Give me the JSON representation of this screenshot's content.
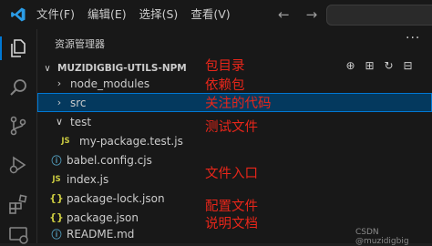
{
  "menu": {
    "items": [
      "文件(F)",
      "编辑(E)",
      "选择(S)",
      "查看(V)"
    ]
  },
  "explorer": {
    "title": "资源管理器",
    "more": "···",
    "project": "MUZIDIGBIG-UTILS-NPM",
    "tree": [
      {
        "label": "node_modules",
        "type": "folder",
        "expanded": false
      },
      {
        "label": "src",
        "type": "folder",
        "expanded": false,
        "selected": true
      },
      {
        "label": "test",
        "type": "folder",
        "expanded": true
      },
      {
        "label": "my-package.test.js",
        "type": "file",
        "icon": "JS"
      },
      {
        "label": "babel.config.cjs",
        "type": "file",
        "icon": "info"
      },
      {
        "label": "index.js",
        "type": "file",
        "icon": "JS"
      },
      {
        "label": "package-lock.json",
        "type": "file",
        "icon": "{}"
      },
      {
        "label": "package.json",
        "type": "file",
        "icon": "{}"
      },
      {
        "label": "README.md",
        "type": "file",
        "icon": "info"
      }
    ]
  },
  "annotations": [
    "包目录",
    "依赖包",
    "关注的代码",
    "测试文件",
    "文件入口",
    "配置文件",
    "说明文档"
  ],
  "watermark": "CSDN @muzidigbig",
  "colors": {
    "accent": "#0078d4",
    "annotation": "#e8261a",
    "selected_row": "#04395e"
  }
}
